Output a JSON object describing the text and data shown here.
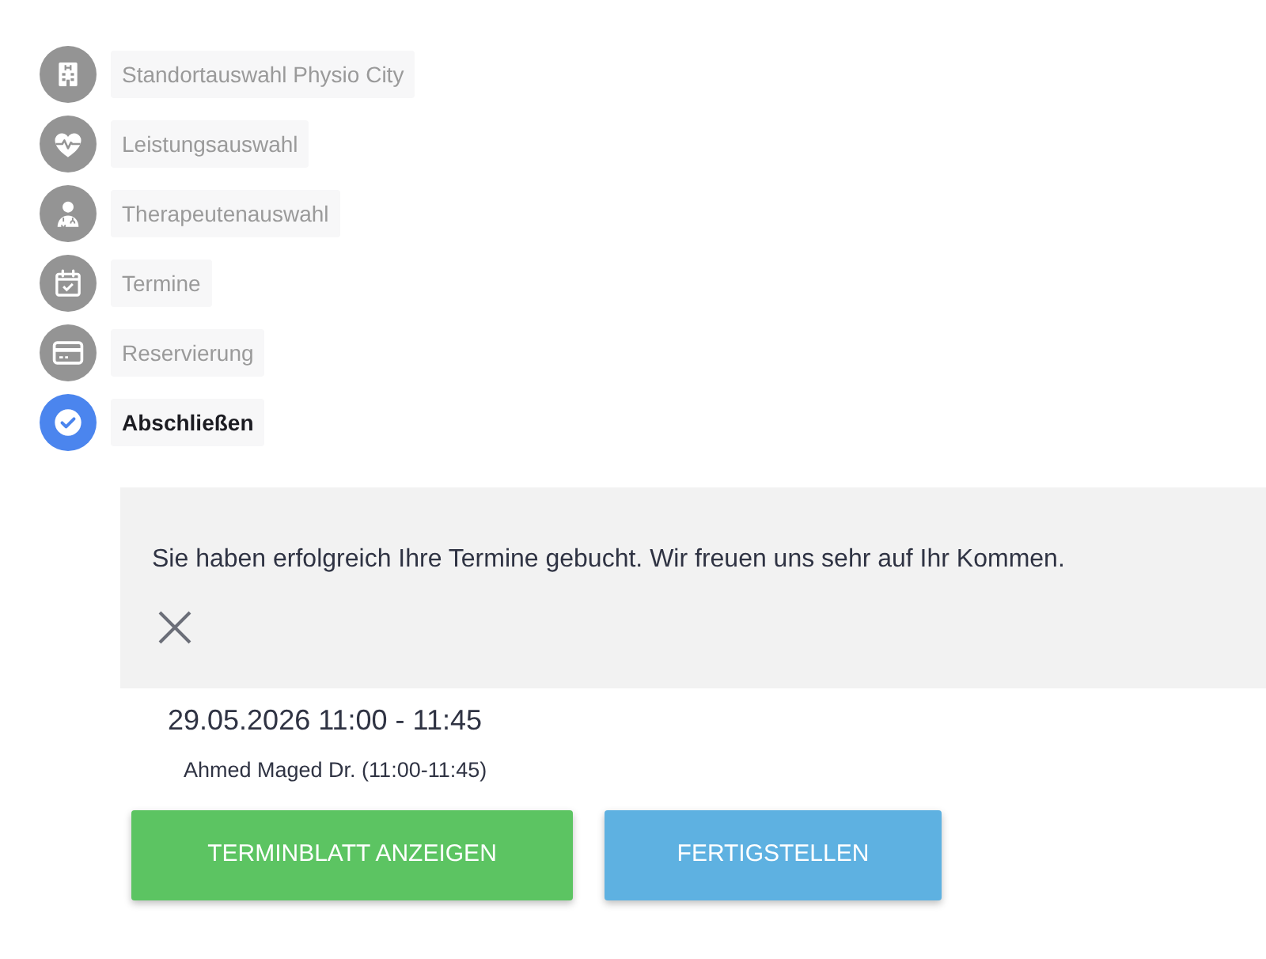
{
  "steps": [
    {
      "label": "Standortauswahl Physio City",
      "current": false
    },
    {
      "label": "Leistungsauswahl",
      "current": false
    },
    {
      "label": "Therapeutenauswahl",
      "current": false
    },
    {
      "label": "Termine",
      "current": false
    },
    {
      "label": "Reservierung",
      "current": false
    },
    {
      "label": "Abschließen",
      "current": true
    }
  ],
  "alert": {
    "message": "Sie haben erfolgreich Ihre Termine gebucht. Wir freuen uns sehr auf Ihr Kommen."
  },
  "appointment": {
    "datetime": "29.05.2026 11:00 - 11:45",
    "therapist": "Ahmed Maged Dr. (11:00-11:45)"
  },
  "buttons": [
    {
      "label": "TERMINBLATT ANZEIGEN",
      "kind": "success"
    },
    {
      "label": "FERTIGSTELLEN",
      "kind": "primary"
    }
  ]
}
